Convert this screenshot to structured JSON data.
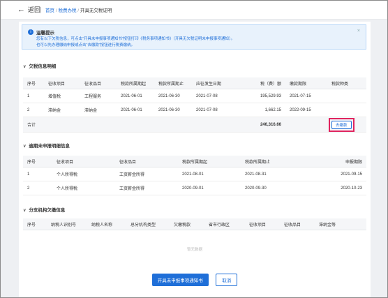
{
  "header": {
    "back_label": "返回",
    "breadcrumb": [
      "首页",
      "税费办税",
      "开具无欠税证明"
    ]
  },
  "tip": {
    "title": "温馨提示",
    "line1": "您有以下欠税信息，可点击“开具未申报事项通知书”按钮打印《税务事项通知书》（开具无欠税证明未申报事项通知）。",
    "line2": "也可以先办理缴纳申报或点击“去缴款”按钮进行税费缴纳。",
    "close_icon": "close-icon"
  },
  "arrears": {
    "title": "欠税信息明细",
    "columns": [
      "序号",
      "征收项目",
      "征收品目",
      "税款所属期起",
      "税款所属期止",
      "应征发生日期",
      "税（费）额",
      "缴款期限",
      "税款种类"
    ],
    "rows": [
      [
        "1",
        "增值税",
        "工程服务",
        "2021-06-01",
        "2021-06-30",
        "2021-07-08",
        "195,529.93",
        "2021-07-15",
        ""
      ],
      [
        "2",
        "滞纳金",
        "滞纳金",
        "2021-06-01",
        "2021-06-30",
        "2021-07-08",
        "1,662.15",
        "2022-09-15",
        ""
      ]
    ],
    "total_label": "合计",
    "total_value": "246,316.66",
    "pay_button": "去缴款"
  },
  "overdue": {
    "title": "逾期未申报明细信息",
    "columns": [
      "序号",
      "征收项目",
      "征收品目",
      "税款所属期起",
      "税款所属期止",
      "申报期限"
    ],
    "rows": [
      [
        "1",
        "个人所得税",
        "工资薪金所得",
        "2021-08-01",
        "2021-08-31",
        "2021-09-15"
      ],
      [
        "2",
        "个人所得税",
        "工资薪金所得",
        "2020-09-01",
        "2020-09-30",
        "2020-10-23"
      ]
    ]
  },
  "branch": {
    "title": "分支机构欠缴信息",
    "columns": [
      "序号",
      "纳税人识别号",
      "纳税人名称",
      "总分机构类型",
      "欠缴税款",
      "省市行政区",
      "征收项目",
      "征收品目",
      "滞纳金等"
    ],
    "empty_text": "暂无数据"
  },
  "actions": {
    "primary": "开具未申报事项通知书",
    "cancel": "取消"
  },
  "colors": {
    "accent": "#1f6fd8",
    "highlight": "#e0245e"
  }
}
